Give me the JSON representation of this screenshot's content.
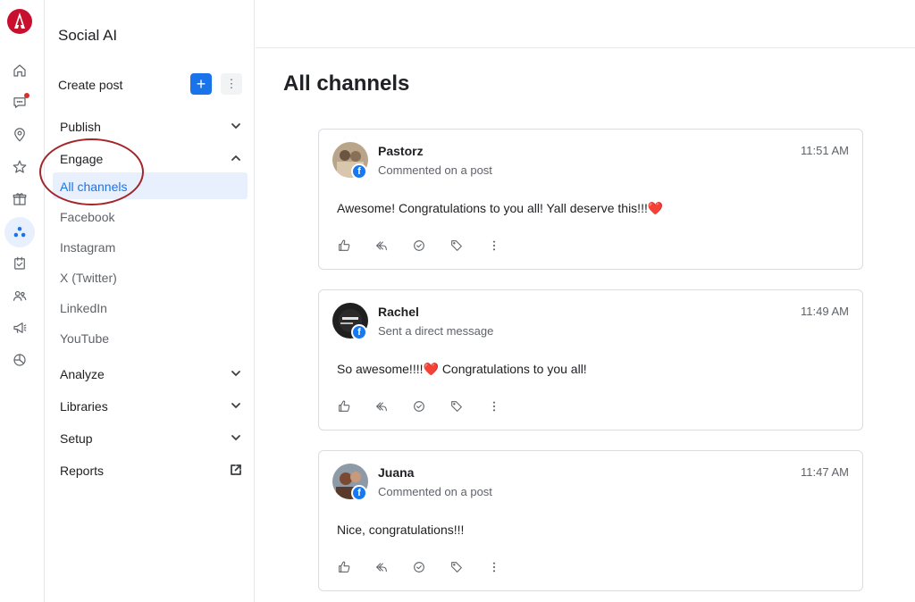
{
  "app": {
    "title": "Social AI"
  },
  "sidebar": {
    "create_post_label": "Create post",
    "groups": {
      "publish": "Publish",
      "engage": "Engage",
      "analyze": "Analyze",
      "libraries": "Libraries",
      "setup": "Setup",
      "reports": "Reports"
    },
    "engage_items": [
      "All channels",
      "Facebook",
      "Instagram",
      "X (Twitter)",
      "LinkedIn",
      "YouTube"
    ]
  },
  "rail_icons": [
    "home-icon",
    "chat-icon",
    "location-pin-icon",
    "star-icon",
    "gift-icon",
    "social-icon",
    "checklist-icon",
    "contacts-icon",
    "megaphone-icon",
    "chart-pie-icon"
  ],
  "main": {
    "title": "All channels",
    "posts": [
      {
        "author": "Pastorz",
        "activity": "Commented on a post",
        "time": "11:51 AM",
        "message": "Awesome! Congratulations to you all! Yall deserve this!!!",
        "message_suffix": "❤️",
        "platform": "f"
      },
      {
        "author": "Rachel",
        "activity": "Sent a direct message",
        "time": "11:49 AM",
        "message": "So awesome!!!!",
        "message_suffix": "❤️ Congratulations to you all!",
        "platform": "f"
      },
      {
        "author": "Juana",
        "activity": "Commented on a post",
        "time": "11:47 AM",
        "message": "Nice, congratulations!!!",
        "message_suffix": "",
        "platform": "f"
      }
    ]
  },
  "colors": {
    "accent": "#1a73e8",
    "annotation": "#a3262a",
    "facebook": "#1877f2"
  }
}
